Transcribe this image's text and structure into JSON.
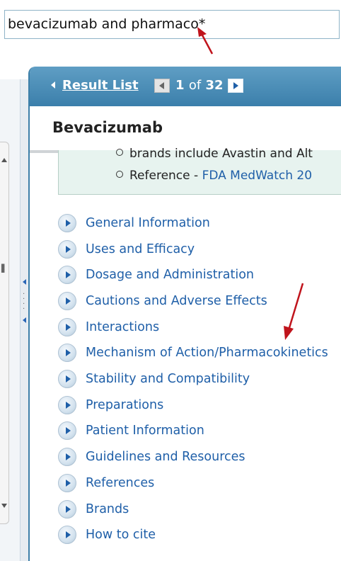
{
  "search": {
    "value": "bevacizumab and pharmaco*"
  },
  "nav": {
    "result_list": "Result List",
    "page_current": "1",
    "page_of": "of",
    "page_total": "32"
  },
  "page": {
    "title": "Bevacizumab"
  },
  "info_box": {
    "bullets": [
      {
        "text": "brands include Avastin and Alt"
      },
      {
        "prefix": "Reference - ",
        "link": "FDA MedWatch 20"
      }
    ]
  },
  "toc": [
    "General Information",
    "Uses and Efficacy",
    "Dosage and Administration",
    "Cautions and Adverse Effects",
    "Interactions",
    "Mechanism of Action/Pharmacokinetics",
    "Stability and Compatibility",
    "Preparations",
    "Patient Information",
    "Guidelines and Resources",
    "References",
    "Brands",
    "How to cite"
  ],
  "colors": {
    "annotation_arrow": "#c0141c",
    "link": "#1f5fa8",
    "nav_bar": "#4a8cb6"
  }
}
